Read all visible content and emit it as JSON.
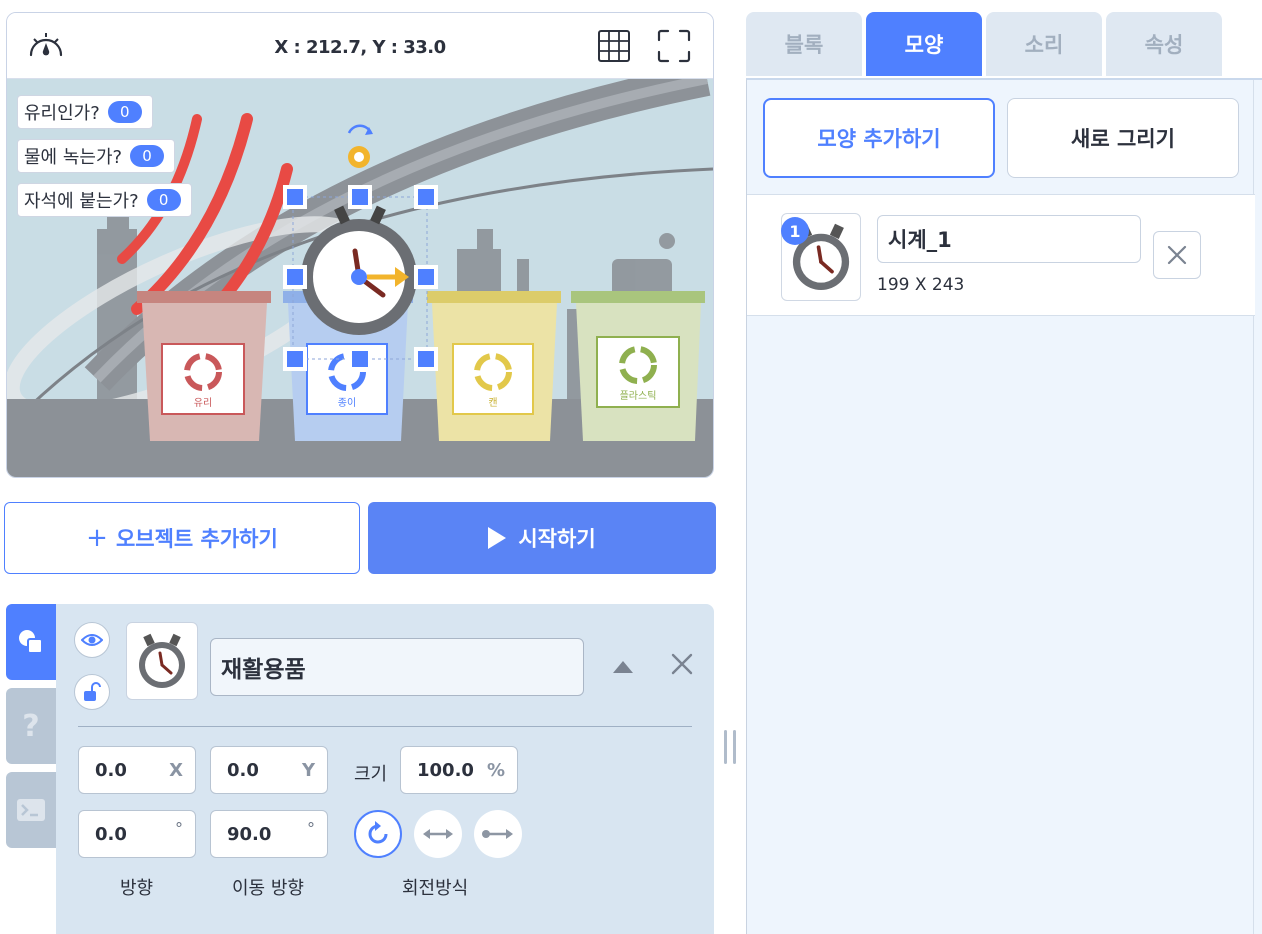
{
  "stage": {
    "coords": "X : 212.7, Y : 33.0",
    "variables": [
      {
        "label": "유리인가?",
        "value": "0"
      },
      {
        "label": "물에 녹는가?",
        "value": "0"
      },
      {
        "label": "자석에 붙는가?",
        "value": "0"
      }
    ],
    "bins": [
      {
        "label": "유리",
        "color": "#c9585a"
      },
      {
        "label": "종이",
        "color": "#4f80ff"
      },
      {
        "label": "캔",
        "color": "#e2c84a"
      },
      {
        "label": "플라스틱",
        "color": "#8fb04f"
      }
    ]
  },
  "actions": {
    "add_object": "오브젝트 추가하기",
    "add_object_icon": "plus",
    "start": "시작하기"
  },
  "object": {
    "name": "재활용품",
    "x": "0.0",
    "x_unit": "X",
    "y": "0.0",
    "y_unit": "Y",
    "size_label": "크기",
    "size": "100.0",
    "size_unit": "%",
    "direction": "0.0",
    "move_direction": "90.0",
    "degree": "°",
    "direction_label": "방향",
    "move_direction_label": "이동 방향",
    "rotation_label": "회전방식",
    "help_tab": "?"
  },
  "tabs": [
    {
      "label": "블록",
      "active": false
    },
    {
      "label": "모양",
      "active": true
    },
    {
      "label": "소리",
      "active": false
    },
    {
      "label": "속성",
      "active": false
    }
  ],
  "shapes_panel": {
    "add_shape": "모양 추가하기",
    "draw_new": "새로 그리기",
    "items": [
      {
        "index": "1",
        "name": "시계_1",
        "size": "199 X 243"
      }
    ]
  },
  "colors": {
    "accent": "#4f80ff",
    "start_button": "#5a84f5",
    "panel_bg": "#d8e5f1",
    "right_panel_bg": "#eef5fd"
  }
}
